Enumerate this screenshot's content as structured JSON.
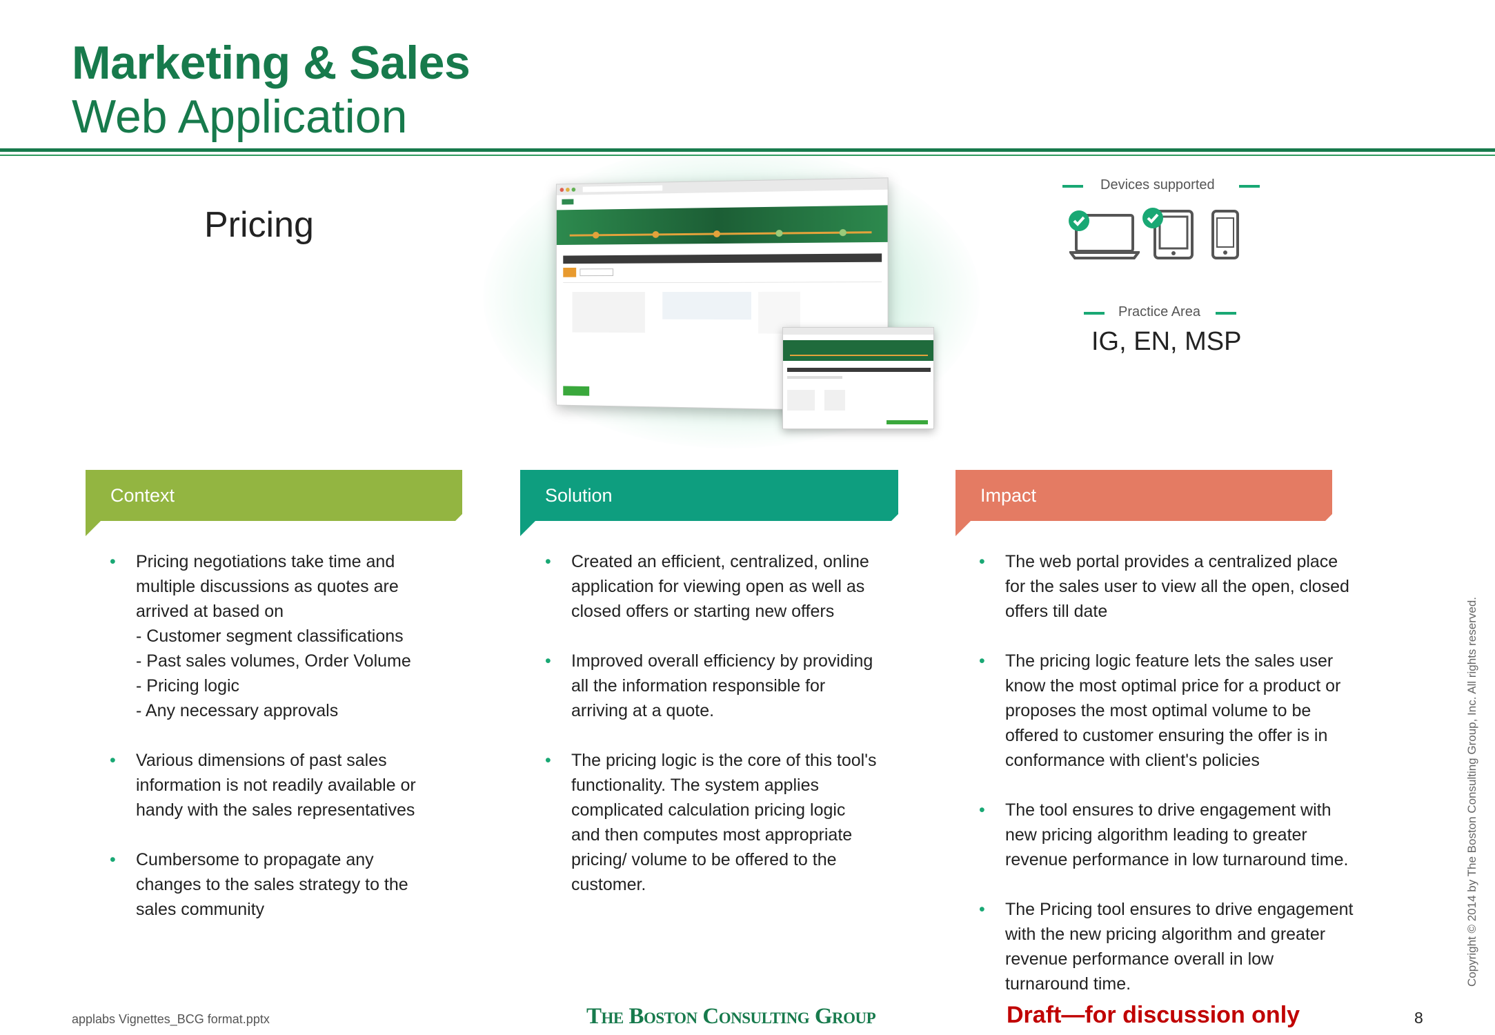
{
  "header": {
    "title_line1": "Marketing & Sales",
    "title_line2": "Web Application"
  },
  "section_label": "Pricing",
  "sidebar": {
    "devices_label": "Devices supported",
    "devices": [
      {
        "name": "laptop-icon",
        "supported": true
      },
      {
        "name": "tablet-icon",
        "supported": true
      },
      {
        "name": "phone-icon",
        "supported": false
      }
    ],
    "practice_area_label": "Practice Area",
    "practice_area_value": "IG, EN, MSP"
  },
  "colors": {
    "brand_green": "#177a4c",
    "context": "#93b541",
    "solution": "#0e9e7f",
    "impact": "#e47b63",
    "bullet": "#19a874",
    "draft": "#c00000"
  },
  "context": {
    "heading": "Context",
    "items": [
      {
        "lines": [
          "Pricing negotiations take time and",
          "multiple discussions as quotes are",
          "arrived at based on"
        ],
        "sub": [
          "-  Customer segment classifications",
          "-  Past sales volumes, Order Volume",
          "-  Pricing logic",
          "-  Any necessary approvals"
        ]
      },
      {
        "lines": [
          "Various dimensions of past sales",
          "information is not readily available or",
          "handy with the sales representatives"
        ],
        "sub": []
      },
      {
        "lines": [
          "Cumbersome to propagate any",
          "changes to the sales strategy to the",
          "sales community"
        ],
        "sub": []
      }
    ]
  },
  "solution": {
    "heading": "Solution",
    "items": [
      {
        "lines": [
          "Created an efficient, centralized, online",
          "application for viewing open as well as",
          "closed offers or starting new offers"
        ],
        "sub": []
      },
      {
        "lines": [
          "Improved overall efficiency by providing",
          "all the information responsible for",
          "arriving at a quote."
        ],
        "sub": []
      },
      {
        "lines": [
          "The pricing logic is the core of this tool's",
          "functionality. The system applies",
          "complicated calculation pricing logic",
          "and then computes most appropriate",
          "pricing/ volume to be offered to the",
          "customer."
        ],
        "sub": []
      }
    ]
  },
  "impact": {
    "heading": "Impact",
    "items": [
      {
        "lines": [
          "The web portal provides a centralized place",
          "for the sales user to view all the open, closed",
          "offers till date"
        ],
        "sub": []
      },
      {
        "lines": [
          "The pricing logic feature lets the sales user",
          "know the most optimal price for a product or",
          "proposes the most optimal volume to be",
          "offered to customer ensuring the offer is in",
          "conformance with client's policies"
        ],
        "sub": []
      },
      {
        "lines": [
          "The tool ensures to drive engagement with",
          "new pricing algorithm leading to greater",
          "revenue performance in low turnaround time."
        ],
        "sub": []
      },
      {
        "lines": [
          "The Pricing tool ensures to drive engagement",
          "with the new pricing algorithm and greater",
          "revenue performance overall in low",
          "turnaround time."
        ],
        "sub": []
      }
    ]
  },
  "footer": {
    "filename": "applabs Vignettes_BCG format.pptx",
    "logo_text": "The Boston Consulting Group",
    "draft": "Draft—for discussion only",
    "page_number": "8",
    "copyright": "Copyright © 2014 by The Boston Consulting Group, Inc. All rights reserved."
  }
}
